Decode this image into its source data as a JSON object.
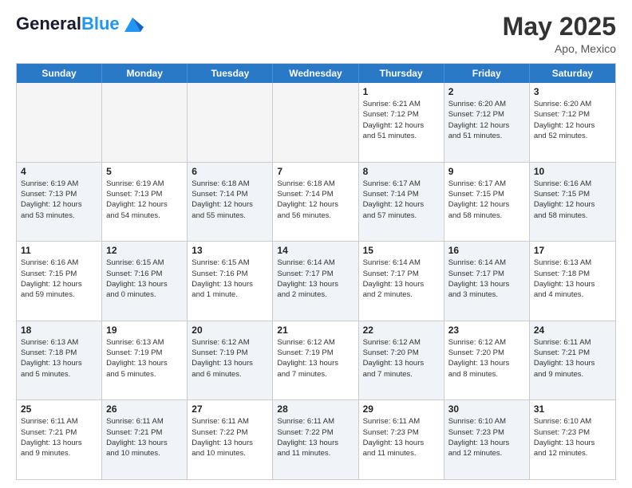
{
  "header": {
    "logo_general": "General",
    "logo_blue": "Blue",
    "month_title": "May 2025",
    "location": "Apo, Mexico"
  },
  "weekdays": [
    "Sunday",
    "Monday",
    "Tuesday",
    "Wednesday",
    "Thursday",
    "Friday",
    "Saturday"
  ],
  "rows": [
    [
      {
        "day": "",
        "info": "",
        "shaded": false,
        "empty": true
      },
      {
        "day": "",
        "info": "",
        "shaded": false,
        "empty": true
      },
      {
        "day": "",
        "info": "",
        "shaded": false,
        "empty": true
      },
      {
        "day": "",
        "info": "",
        "shaded": false,
        "empty": true
      },
      {
        "day": "1",
        "info": "Sunrise: 6:21 AM\nSunset: 7:12 PM\nDaylight: 12 hours\nand 51 minutes.",
        "shaded": false,
        "empty": false
      },
      {
        "day": "2",
        "info": "Sunrise: 6:20 AM\nSunset: 7:12 PM\nDaylight: 12 hours\nand 51 minutes.",
        "shaded": true,
        "empty": false
      },
      {
        "day": "3",
        "info": "Sunrise: 6:20 AM\nSunset: 7:12 PM\nDaylight: 12 hours\nand 52 minutes.",
        "shaded": false,
        "empty": false
      }
    ],
    [
      {
        "day": "4",
        "info": "Sunrise: 6:19 AM\nSunset: 7:13 PM\nDaylight: 12 hours\nand 53 minutes.",
        "shaded": true,
        "empty": false
      },
      {
        "day": "5",
        "info": "Sunrise: 6:19 AM\nSunset: 7:13 PM\nDaylight: 12 hours\nand 54 minutes.",
        "shaded": false,
        "empty": false
      },
      {
        "day": "6",
        "info": "Sunrise: 6:18 AM\nSunset: 7:14 PM\nDaylight: 12 hours\nand 55 minutes.",
        "shaded": true,
        "empty": false
      },
      {
        "day": "7",
        "info": "Sunrise: 6:18 AM\nSunset: 7:14 PM\nDaylight: 12 hours\nand 56 minutes.",
        "shaded": false,
        "empty": false
      },
      {
        "day": "8",
        "info": "Sunrise: 6:17 AM\nSunset: 7:14 PM\nDaylight: 12 hours\nand 57 minutes.",
        "shaded": true,
        "empty": false
      },
      {
        "day": "9",
        "info": "Sunrise: 6:17 AM\nSunset: 7:15 PM\nDaylight: 12 hours\nand 58 minutes.",
        "shaded": false,
        "empty": false
      },
      {
        "day": "10",
        "info": "Sunrise: 6:16 AM\nSunset: 7:15 PM\nDaylight: 12 hours\nand 58 minutes.",
        "shaded": true,
        "empty": false
      }
    ],
    [
      {
        "day": "11",
        "info": "Sunrise: 6:16 AM\nSunset: 7:15 PM\nDaylight: 12 hours\nand 59 minutes.",
        "shaded": false,
        "empty": false
      },
      {
        "day": "12",
        "info": "Sunrise: 6:15 AM\nSunset: 7:16 PM\nDaylight: 13 hours\nand 0 minutes.",
        "shaded": true,
        "empty": false
      },
      {
        "day": "13",
        "info": "Sunrise: 6:15 AM\nSunset: 7:16 PM\nDaylight: 13 hours\nand 1 minute.",
        "shaded": false,
        "empty": false
      },
      {
        "day": "14",
        "info": "Sunrise: 6:14 AM\nSunset: 7:17 PM\nDaylight: 13 hours\nand 2 minutes.",
        "shaded": true,
        "empty": false
      },
      {
        "day": "15",
        "info": "Sunrise: 6:14 AM\nSunset: 7:17 PM\nDaylight: 13 hours\nand 2 minutes.",
        "shaded": false,
        "empty": false
      },
      {
        "day": "16",
        "info": "Sunrise: 6:14 AM\nSunset: 7:17 PM\nDaylight: 13 hours\nand 3 minutes.",
        "shaded": true,
        "empty": false
      },
      {
        "day": "17",
        "info": "Sunrise: 6:13 AM\nSunset: 7:18 PM\nDaylight: 13 hours\nand 4 minutes.",
        "shaded": false,
        "empty": false
      }
    ],
    [
      {
        "day": "18",
        "info": "Sunrise: 6:13 AM\nSunset: 7:18 PM\nDaylight: 13 hours\nand 5 minutes.",
        "shaded": true,
        "empty": false
      },
      {
        "day": "19",
        "info": "Sunrise: 6:13 AM\nSunset: 7:19 PM\nDaylight: 13 hours\nand 5 minutes.",
        "shaded": false,
        "empty": false
      },
      {
        "day": "20",
        "info": "Sunrise: 6:12 AM\nSunset: 7:19 PM\nDaylight: 13 hours\nand 6 minutes.",
        "shaded": true,
        "empty": false
      },
      {
        "day": "21",
        "info": "Sunrise: 6:12 AM\nSunset: 7:19 PM\nDaylight: 13 hours\nand 7 minutes.",
        "shaded": false,
        "empty": false
      },
      {
        "day": "22",
        "info": "Sunrise: 6:12 AM\nSunset: 7:20 PM\nDaylight: 13 hours\nand 7 minutes.",
        "shaded": true,
        "empty": false
      },
      {
        "day": "23",
        "info": "Sunrise: 6:12 AM\nSunset: 7:20 PM\nDaylight: 13 hours\nand 8 minutes.",
        "shaded": false,
        "empty": false
      },
      {
        "day": "24",
        "info": "Sunrise: 6:11 AM\nSunset: 7:21 PM\nDaylight: 13 hours\nand 9 minutes.",
        "shaded": true,
        "empty": false
      }
    ],
    [
      {
        "day": "25",
        "info": "Sunrise: 6:11 AM\nSunset: 7:21 PM\nDaylight: 13 hours\nand 9 minutes.",
        "shaded": false,
        "empty": false
      },
      {
        "day": "26",
        "info": "Sunrise: 6:11 AM\nSunset: 7:21 PM\nDaylight: 13 hours\nand 10 minutes.",
        "shaded": true,
        "empty": false
      },
      {
        "day": "27",
        "info": "Sunrise: 6:11 AM\nSunset: 7:22 PM\nDaylight: 13 hours\nand 10 minutes.",
        "shaded": false,
        "empty": false
      },
      {
        "day": "28",
        "info": "Sunrise: 6:11 AM\nSunset: 7:22 PM\nDaylight: 13 hours\nand 11 minutes.",
        "shaded": true,
        "empty": false
      },
      {
        "day": "29",
        "info": "Sunrise: 6:11 AM\nSunset: 7:23 PM\nDaylight: 13 hours\nand 11 minutes.",
        "shaded": false,
        "empty": false
      },
      {
        "day": "30",
        "info": "Sunrise: 6:10 AM\nSunset: 7:23 PM\nDaylight: 13 hours\nand 12 minutes.",
        "shaded": true,
        "empty": false
      },
      {
        "day": "31",
        "info": "Sunrise: 6:10 AM\nSunset: 7:23 PM\nDaylight: 13 hours\nand 12 minutes.",
        "shaded": false,
        "empty": false
      }
    ]
  ]
}
